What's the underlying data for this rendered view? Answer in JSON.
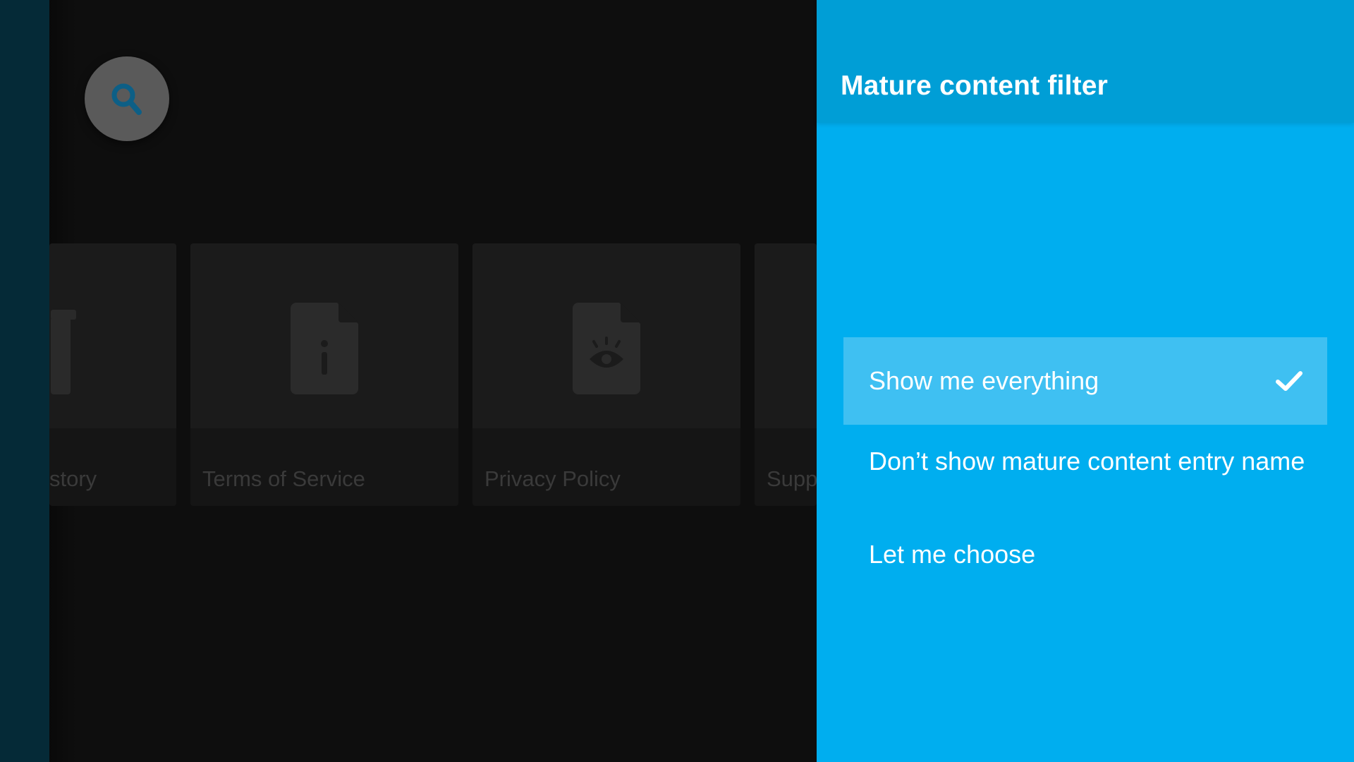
{
  "background": {
    "cards": [
      {
        "label": "story",
        "icon": "trash-document-icon"
      },
      {
        "label": "Terms of Service",
        "icon": "info-document-icon"
      },
      {
        "label": "Privacy Policy",
        "icon": "eye-document-icon"
      },
      {
        "label": "Supp",
        "icon": "document-icon"
      }
    ]
  },
  "dialog": {
    "title": "Mature content filter",
    "options": [
      {
        "label": "Show me everything",
        "selected": true
      },
      {
        "label": "Don’t show mature content entry name",
        "selected": false
      },
      {
        "label": "Let me choose",
        "selected": false
      }
    ]
  },
  "colors": {
    "panel": "#00aeef",
    "panel_header": "#009ed6",
    "selected_option": "#3fc0f2",
    "rail": "#052a37"
  }
}
